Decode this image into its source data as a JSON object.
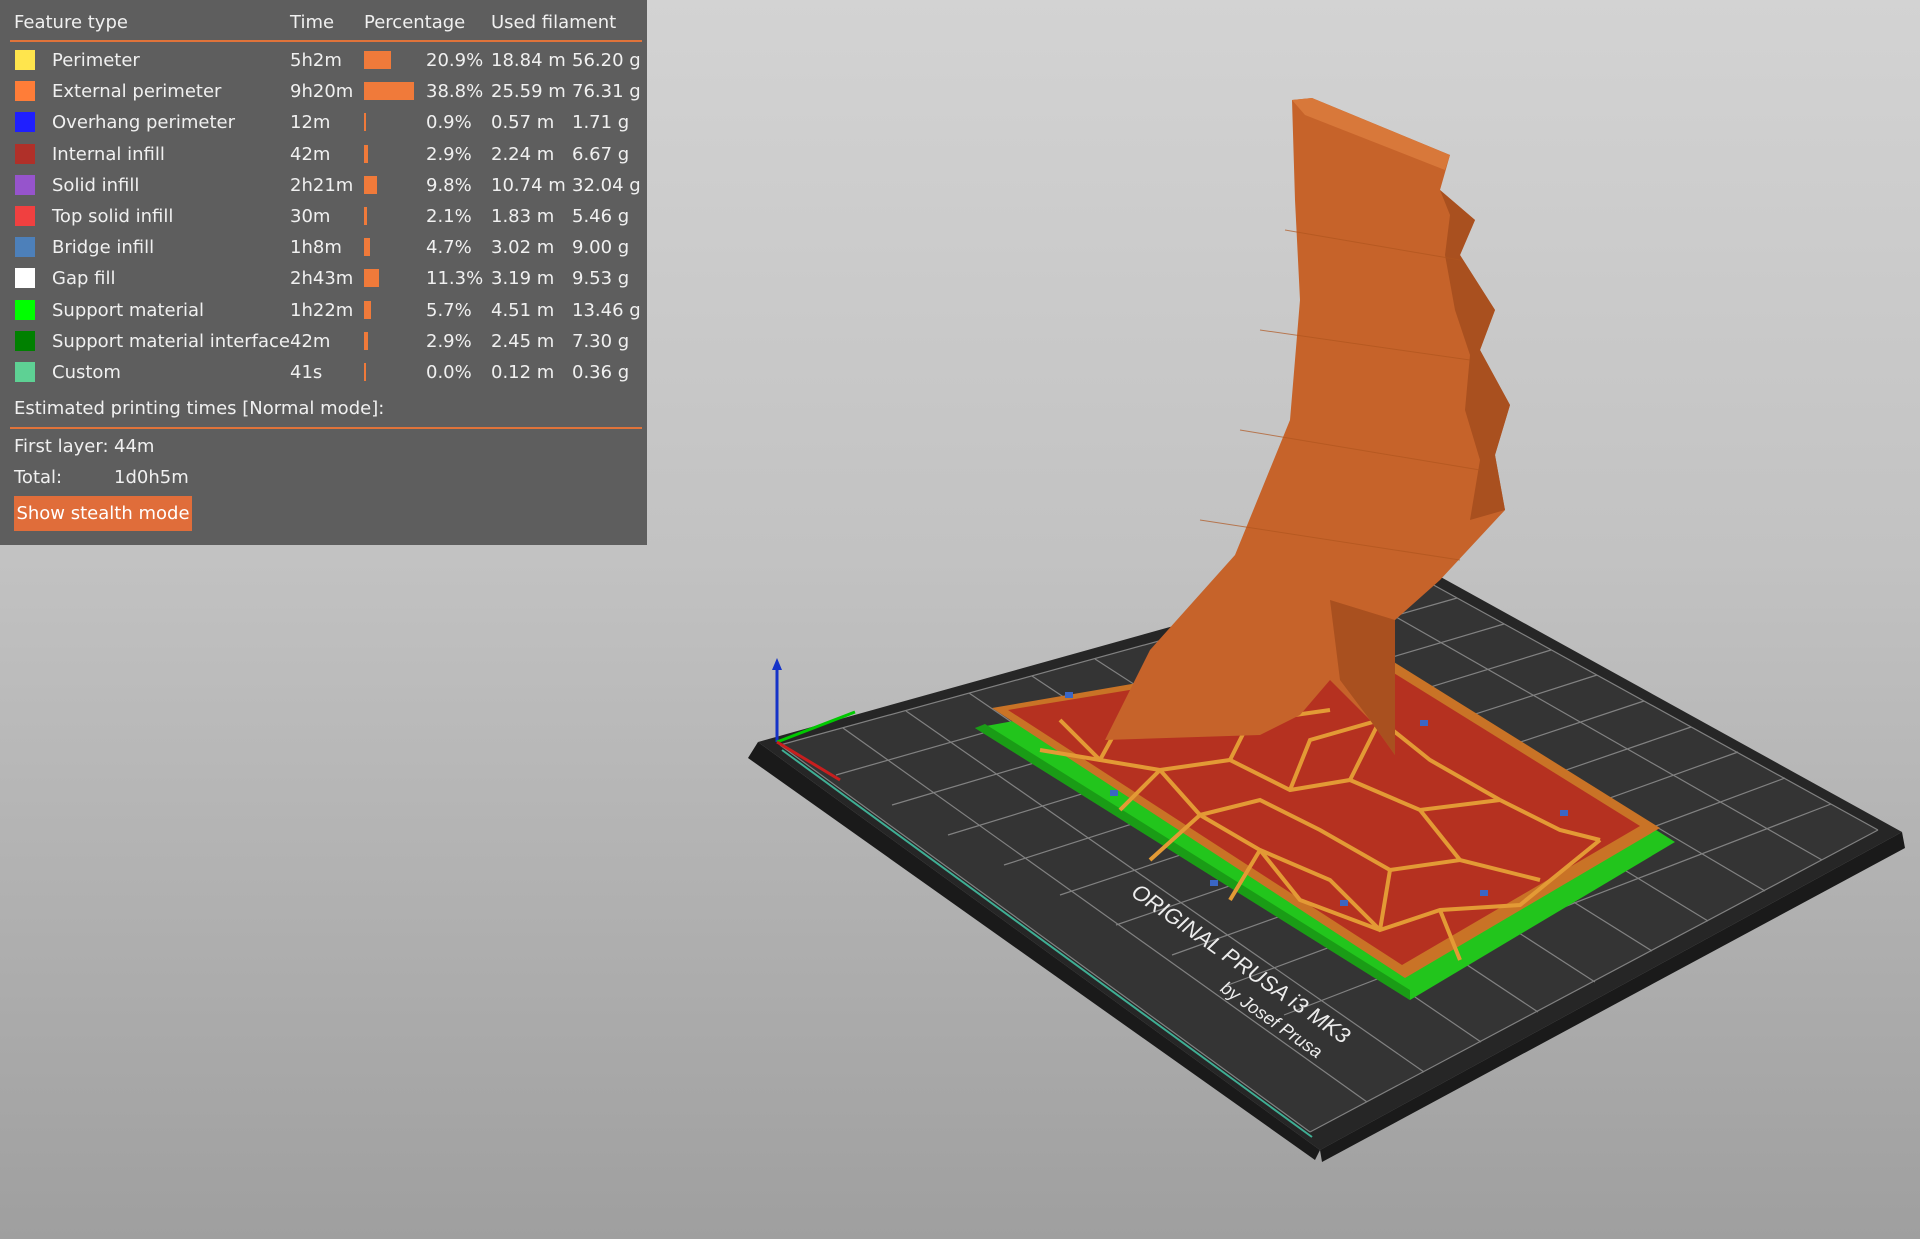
{
  "legend": {
    "headers": {
      "feature_type": "Feature type",
      "time": "Time",
      "percentage": "Percentage",
      "used_filament": "Used filament"
    },
    "rows": [
      {
        "name": "Perimeter",
        "time": "5h2m",
        "pct": "20.9%",
        "pct_value": 20.9,
        "length": "18.84 m",
        "weight": "56.20 g",
        "color": "#ffe54d"
      },
      {
        "name": "External perimeter",
        "time": "9h20m",
        "pct": "38.8%",
        "pct_value": 38.8,
        "length": "25.59 m",
        "weight": "76.31 g",
        "color": "#ff7d38"
      },
      {
        "name": "Overhang perimeter",
        "time": "12m",
        "pct": "0.9%",
        "pct_value": 0.9,
        "length": "0.57 m",
        "weight": "1.71 g",
        "color": "#1f1fff"
      },
      {
        "name": "Internal infill",
        "time": "42m",
        "pct": "2.9%",
        "pct_value": 2.9,
        "length": "2.24 m",
        "weight": "6.67 g",
        "color": "#b03029"
      },
      {
        "name": "Solid infill",
        "time": "2h21m",
        "pct": "9.8%",
        "pct_value": 9.8,
        "length": "10.74 m",
        "weight": "32.04 g",
        "color": "#9654cc"
      },
      {
        "name": "Top solid infill",
        "time": "30m",
        "pct": "2.1%",
        "pct_value": 2.1,
        "length": "1.83 m",
        "weight": "5.46 g",
        "color": "#f04040"
      },
      {
        "name": "Bridge infill",
        "time": "1h8m",
        "pct": "4.7%",
        "pct_value": 4.7,
        "length": "3.02 m",
        "weight": "9.00 g",
        "color": "#4d80ba"
      },
      {
        "name": "Gap fill",
        "time": "2h43m",
        "pct": "11.3%",
        "pct_value": 11.3,
        "length": "3.19 m",
        "weight": "9.53 g",
        "color": "#ffffff"
      },
      {
        "name": "Support material",
        "time": "1h22m",
        "pct": "5.7%",
        "pct_value": 5.7,
        "length": "4.51 m",
        "weight": "13.46 g",
        "color": "#00ff00"
      },
      {
        "name": "Support material interface",
        "time": "42m",
        "pct": "2.9%",
        "pct_value": 2.9,
        "length": "2.45 m",
        "weight": "7.30 g",
        "color": "#008000"
      },
      {
        "name": "Custom",
        "time": "41s",
        "pct": "0.0%",
        "pct_value": 0.0,
        "length": "0.12 m",
        "weight": "0.36 g",
        "color": "#5ed194"
      }
    ],
    "estimated_label": "Estimated printing times [Normal mode]:",
    "first_layer_label": "First layer:",
    "first_layer_value": "44m",
    "total_label": "Total:",
    "total_value": "1d0h5m",
    "stealth_button": "Show stealth mode"
  },
  "bed": {
    "brand_line1": "ORIGINAL PRUSA i3 MK3",
    "brand_line2": "by Josef Prusa"
  },
  "colors": {
    "panel_bg": "#5e5e5e",
    "accent": "#e0733a",
    "model": "#c6632a",
    "bed": "#2f2f2f"
  }
}
